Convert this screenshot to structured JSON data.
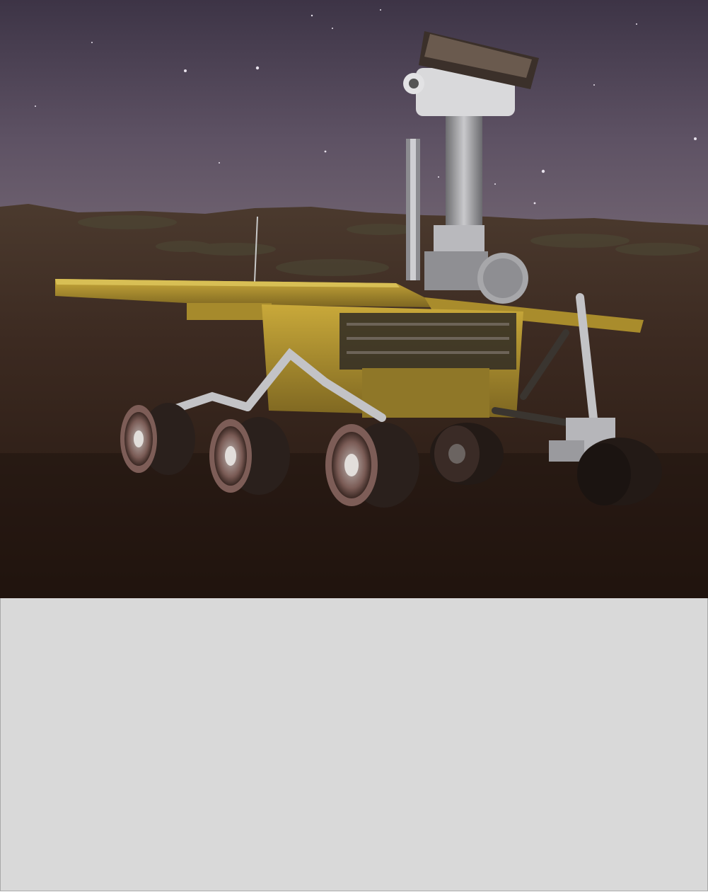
{
  "photo": {
    "subject": "mars-rover-replica-night-scene",
    "colors": {
      "sky_top": "#3f3648",
      "sky_horizon": "#6e6272",
      "ground_near": "#2b1c17",
      "ground_far": "#4a3428",
      "rover_body": "#b89a30",
      "wheel": "#2a211d"
    }
  },
  "panel": {
    "background": "#d9d9d9"
  }
}
